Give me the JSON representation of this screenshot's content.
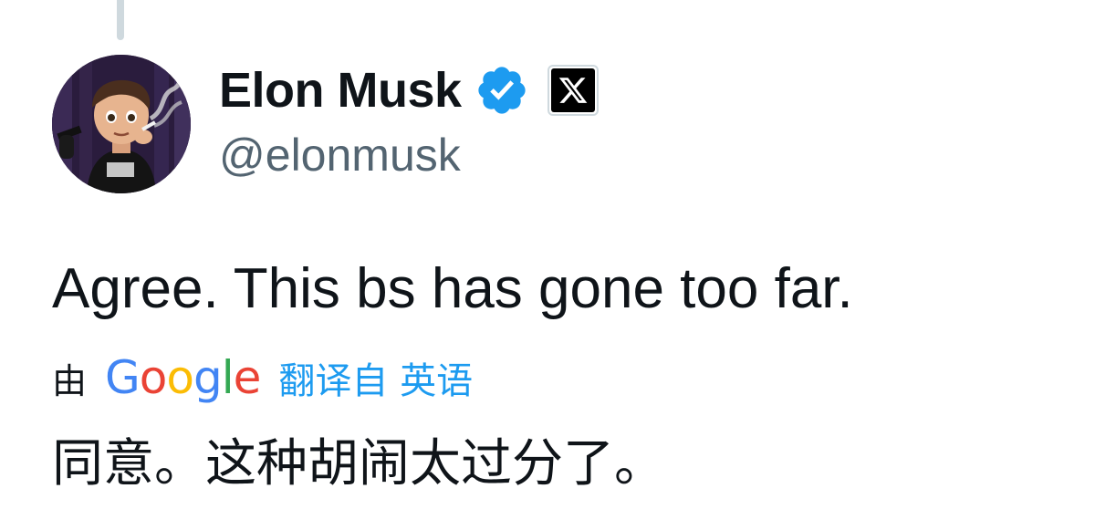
{
  "author": {
    "display_name": "Elon Musk",
    "handle": "@elonmusk",
    "verified_icon": "verified-badge-icon",
    "affiliate_icon": "x-logo-icon"
  },
  "tweet": {
    "text": "Agree. This bs has gone too far."
  },
  "translation": {
    "by_label": "由",
    "provider": {
      "letters": [
        "G",
        "o",
        "o",
        "g",
        "l",
        "e"
      ],
      "colors": [
        "#4285F4",
        "#EA4335",
        "#FBBC05",
        "#4285F4",
        "#34A853",
        "#EA4335"
      ]
    },
    "link_label": "翻译自 英语",
    "translated_text": "同意。这种胡闹太过分了。"
  },
  "colors": {
    "primary_text": "#0f1419",
    "secondary_text": "#536471",
    "accent": "#1d9bf0",
    "verified": "#1d9bf0"
  }
}
